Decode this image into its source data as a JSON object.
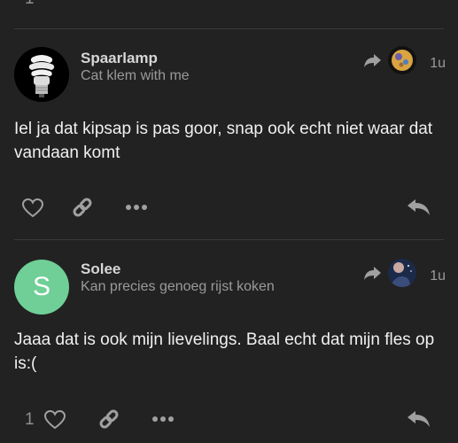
{
  "posts": [
    {
      "username": "Spaarlamp",
      "user_title": "Cat klem with me",
      "time": "1u",
      "body": "Iel ja dat kipsap is pas goor, snap ook echt niet waar dat vandaan komt",
      "like_count": "",
      "avatar_type": "lightbulb-image"
    },
    {
      "username": "Solee",
      "user_title": "Kan precies genoeg rijst koken",
      "time": "1u",
      "body": "Jaaa dat is ook mijn lievelings. Baal echt dat mijn fles op is:(",
      "like_count": "1",
      "avatar_letter": "S",
      "avatar_color": "#6fcf97"
    }
  ],
  "colors": {
    "background": "#222222",
    "text": "#f0f0f0",
    "muted": "#9a9a9a",
    "icon": "#a0a0a0"
  }
}
